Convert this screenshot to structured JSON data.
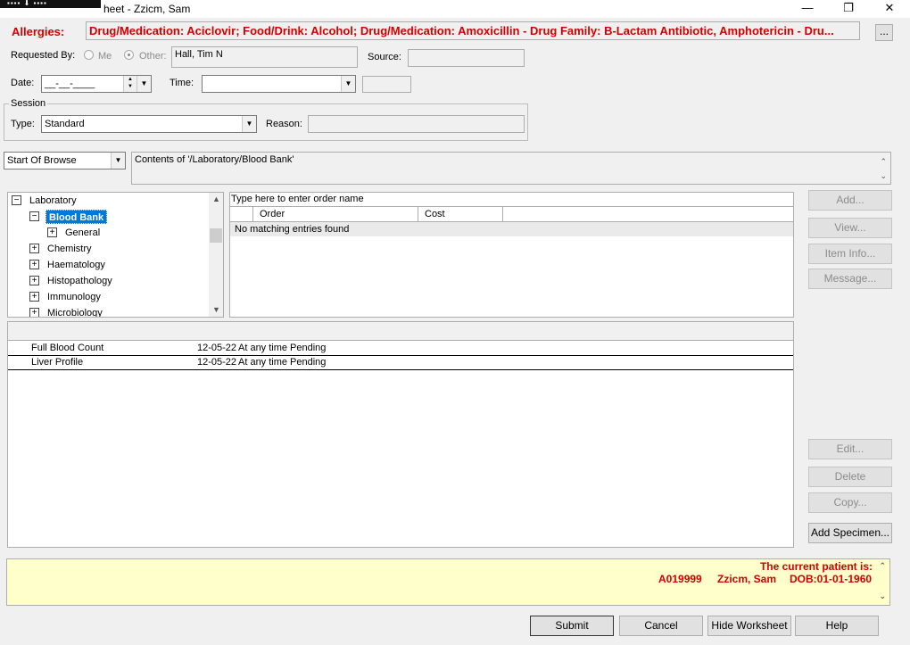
{
  "window": {
    "title": "heet - Zzicm, Sam",
    "minimize": "—",
    "maximize": "❐",
    "close": "✕"
  },
  "allergies": {
    "label": "Allergies:",
    "text": "Drug/Medication: Aciclovir; Food/Drink: Alcohol; Drug/Medication: Amoxicillin - Drug Family: B-Lactam Antibiotic, Amphotericin - Dru...",
    "more_button": "..."
  },
  "requested_by": {
    "label": "Requested By:",
    "me_label": "Me",
    "other_label": "Other:",
    "value": "Hall, Tim N"
  },
  "source": {
    "label": "Source:",
    "value": ""
  },
  "date": {
    "label": "Date:",
    "value": "__-__-____"
  },
  "time": {
    "label": "Time:",
    "value": ""
  },
  "session": {
    "legend": "Session",
    "type_label": "Type:",
    "type_value": "Standard",
    "reason_label": "Reason:",
    "reason_value": ""
  },
  "browse": {
    "select_value": "Start Of Browse",
    "contents": "Contents of '/Laboratory/Blood Bank'"
  },
  "tree": {
    "root": "Laboratory",
    "selected": "Blood Bank",
    "child": "General",
    "items": [
      "Chemistry",
      "Haematology",
      "Histopathology",
      "Immunology",
      "Microbiology"
    ]
  },
  "orders": {
    "search_placeholder": "Type here to enter order name",
    "col_order": "Order",
    "col_cost": "Cost",
    "empty": "No matching entries found"
  },
  "side_buttons": {
    "add": "Add...",
    "view": "View...",
    "item_info": "Item Info...",
    "message": "Message...",
    "edit": "Edit...",
    "delete": "Delete",
    "copy": "Copy...",
    "add_specimen": "Add Specimen..."
  },
  "worksheet": {
    "rows": [
      {
        "name": "Full Blood Count",
        "date": "12-05-22",
        "when": "At any time",
        "status": "Pending"
      },
      {
        "name": "Liver Profile",
        "date": "12-05-22",
        "when": "At any time",
        "status": "Pending"
      }
    ]
  },
  "patient": {
    "heading": "The current patient is:",
    "id": "A019999",
    "name": "Zzicm, Sam",
    "dob": "DOB:01-01-1960"
  },
  "footer": {
    "submit": "Submit",
    "cancel": "Cancel",
    "hide_worksheet": "Hide Worksheet",
    "help": "Help"
  },
  "colors": {
    "accent_red": "#d40000",
    "selection_blue": "#0078d7",
    "patient_bg": "#ffffcc"
  }
}
